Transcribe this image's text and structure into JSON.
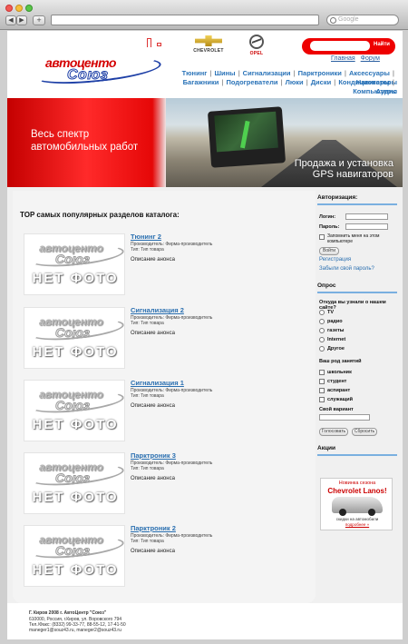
{
  "browser": {
    "search_placeholder": "Google",
    "back": "◀",
    "forward": "▶",
    "add": "+"
  },
  "header": {
    "logo_top": "автоценто",
    "logo_bottom": "Союз",
    "brand1": "CHEVROLET",
    "brand2": "OPEL",
    "search_button": "Найти",
    "top_links": [
      "Главная",
      "Форум"
    ],
    "menu_row1": [
      "Тюнинг",
      "Шины",
      "Сигнализации",
      "Парктроники",
      "Аксессуары",
      "Навигаторы"
    ],
    "menu_row2": [
      "Багажники",
      "Подогреватели",
      "Люки",
      "Диски",
      "Кондиционеры",
      "Компьютеры"
    ],
    "menu_row3": [
      "Аудио"
    ]
  },
  "banner": {
    "left_line1": "Весь спектр",
    "left_line2": "автомобильных работ",
    "right_line1": "Продажа и установка",
    "right_line2": "GPS навигаторов"
  },
  "catalog": {
    "title": "TOP самых популярных  разделов каталога:",
    "no_photo": "НЕТ ФОТО",
    "items": [
      {
        "title": "Тюнинг 2",
        "maker": "Производитель: Фирма-производитель",
        "type": "Тип: Тип товара",
        "desc": "Описание анонса"
      },
      {
        "title": "Сигнализация 2",
        "maker": "Производитель: Фирма-производитель",
        "type": "Тип: Тип товара",
        "desc": "Описание анонса"
      },
      {
        "title": "Сигнализация 1",
        "maker": "Производитель: Фирма-производитель",
        "type": "Тип: Тип товара",
        "desc": "Описание анонса"
      },
      {
        "title": "Парктроник 3",
        "maker": "Производитель: Фирма-производитель",
        "type": "Тип: Тип товара",
        "desc": "Описание анонса"
      },
      {
        "title": "Парктроник 2",
        "maker": "Производитель: Фирма-производитель",
        "type": "Тип: Тип товара",
        "desc": "Описание анонса"
      }
    ]
  },
  "auth": {
    "heading": "Авторизация:",
    "login_label": "Логин:",
    "password_label": "Пароль:",
    "remember_label": "Запомнить меня на этом компьютере",
    "login_button": "Войти",
    "register_link": "Регистрация",
    "forgot_link": "Забыли свой пароль?"
  },
  "poll": {
    "heading": "Опрос",
    "q1": "Откуда вы узнали о нашем сайте?",
    "q1_options": [
      "TV",
      "радио",
      "газеты",
      "Internet",
      "Другое"
    ],
    "q2": "Ваш род занятий",
    "q2_options": [
      "школьник",
      "студент",
      "аспирант",
      "служащий"
    ],
    "own_label": "Свой вариант",
    "vote_button": "Голосовать",
    "reset_button": "Сбросить"
  },
  "promo": {
    "heading": "Акции",
    "line1": "Новинка сезона",
    "line2": "Chevrolet Lanos!",
    "line3": "скидки на автомобили",
    "line4": "подробнее »"
  },
  "footer": {
    "line1": "Г. Киров 2008 г. АвтоЦентр \"Союз\"",
    "line2": "610000, Россия, г.Киров, ул. Воровского 794",
    "line3": "Тел./Факс: (8332) 99-33-77, 88-55-12, 17-41-50",
    "line4": "maneger1@souz43.ru, maneger2@souz43.ru"
  }
}
